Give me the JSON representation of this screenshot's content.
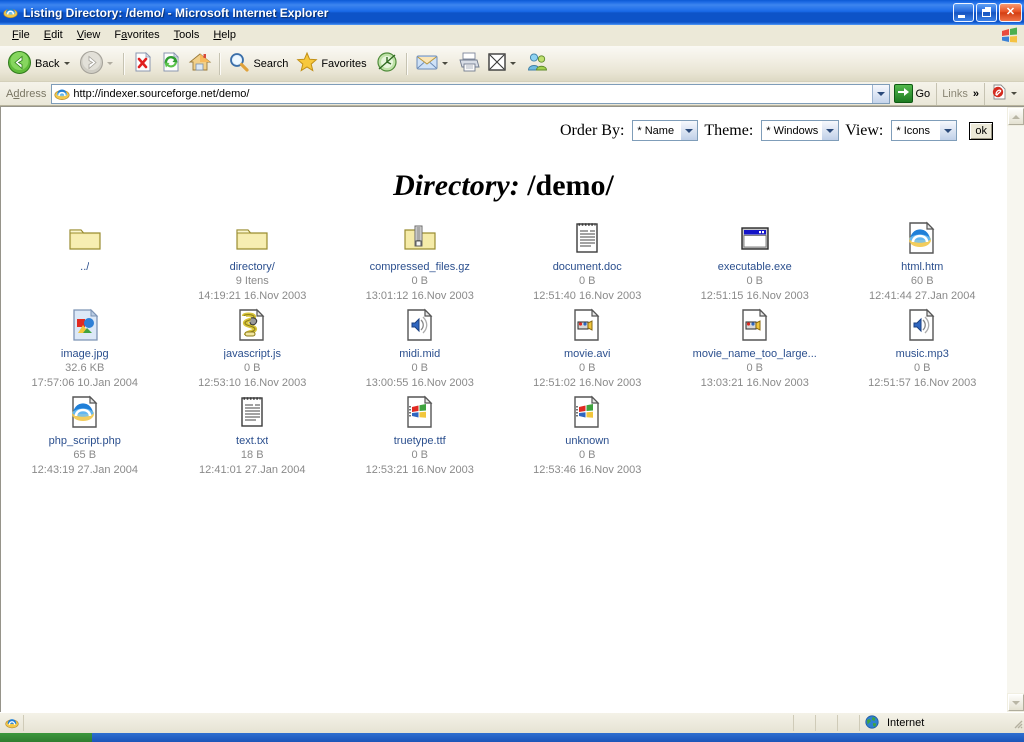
{
  "window": {
    "title": "Listing Directory: /demo/ - Microsoft Internet Explorer",
    "icon": "ie-icon",
    "minimize_label": "Minimize",
    "maximize_label": "Restore",
    "close_label": "Close"
  },
  "menu": {
    "items": [
      {
        "label": "File",
        "accel": "F",
        "rest": "ile"
      },
      {
        "label": "Edit",
        "accel": "E",
        "rest": "dit"
      },
      {
        "label": "View",
        "accel": "V",
        "rest": "iew"
      },
      {
        "label": "Favorites",
        "accel": "a",
        "pre": "F",
        "rest": "vorites"
      },
      {
        "label": "Tools",
        "accel": "T",
        "rest": "ools"
      },
      {
        "label": "Help",
        "accel": "H",
        "rest": "elp"
      }
    ]
  },
  "toolbar": {
    "back_label": "Back",
    "search_label": "Search",
    "favorites_label": "Favorites",
    "buttons": [
      {
        "name": "back-button",
        "icon": "back-arrow-icon"
      },
      {
        "name": "forward-button",
        "icon": "forward-arrow-icon"
      },
      {
        "name": "stop-button",
        "icon": "stop-icon"
      },
      {
        "name": "refresh-button",
        "icon": "refresh-icon"
      },
      {
        "name": "home-button",
        "icon": "home-icon"
      },
      {
        "name": "search-button",
        "icon": "search-icon"
      },
      {
        "name": "favorites-button",
        "icon": "star-icon"
      },
      {
        "name": "history-button",
        "icon": "history-icon"
      },
      {
        "name": "mail-button",
        "icon": "mail-icon"
      },
      {
        "name": "print-button",
        "icon": "printer-icon"
      },
      {
        "name": "edit-button",
        "icon": "edit-page-icon"
      },
      {
        "name": "messenger-button",
        "icon": "messenger-icon"
      }
    ]
  },
  "address": {
    "label": "Address",
    "label_accel": "d",
    "url": "http://indexer.sourceforge.net/demo/",
    "go_label": "Go",
    "links_label": "Links",
    "chevron": "»"
  },
  "page_controls": {
    "order_by_label": "Order By:",
    "order_by_value": "* Name",
    "theme_label": "Theme:",
    "theme_value": "* Windows",
    "view_label": "View:",
    "view_value": "* Icons",
    "ok_label": "ok"
  },
  "heading": {
    "label": "Directory:",
    "path": "/demo/"
  },
  "files": [
    {
      "name": "../",
      "size": "",
      "date": "",
      "icon": "folder-icon"
    },
    {
      "name": "directory/",
      "size": "9 Itens",
      "date": "14:19:21 16.Nov 2003",
      "icon": "folder-icon"
    },
    {
      "name": "compressed_files.gz",
      "size": "0 B",
      "date": "13:01:12 16.Nov 2003",
      "icon": "archive-folder-icon"
    },
    {
      "name": "document.doc",
      "size": "0 B",
      "date": "12:51:40 16.Nov 2003",
      "icon": "document-icon"
    },
    {
      "name": "executable.exe",
      "size": "0 B",
      "date": "12:51:15 16.Nov 2003",
      "icon": "application-window-icon"
    },
    {
      "name": "html.htm",
      "size": "60 B",
      "date": "12:41:44 27.Jan 2004",
      "icon": "html-page-icon"
    },
    {
      "name": "image.jpg",
      "size": "32.6 KB",
      "date": "17:57:06 10.Jan 2004",
      "icon": "image-file-icon"
    },
    {
      "name": "javascript.js",
      "size": "0 B",
      "date": "12:53:10 16.Nov 2003",
      "icon": "script-file-icon"
    },
    {
      "name": "midi.mid",
      "size": "0 B",
      "date": "13:00:55 16.Nov 2003",
      "icon": "audio-file-icon"
    },
    {
      "name": "movie.avi",
      "size": "0 B",
      "date": "12:51:02 16.Nov 2003",
      "icon": "video-file-icon"
    },
    {
      "name": "movie_name_too_large...",
      "size": "0 B",
      "date": "13:03:21 16.Nov 2003",
      "icon": "video-file-icon"
    },
    {
      "name": "music.mp3",
      "size": "0 B",
      "date": "12:51:57 16.Nov 2003",
      "icon": "audio-file-icon"
    },
    {
      "name": "php_script.php",
      "size": "65 B",
      "date": "12:43:19 27.Jan 2004",
      "icon": "html-page-icon"
    },
    {
      "name": "text.txt",
      "size": "18 B",
      "date": "12:41:01 27.Jan 2004",
      "icon": "document-icon"
    },
    {
      "name": "truetype.ttf",
      "size": "0 B",
      "date": "12:53:21 16.Nov 2003",
      "icon": "font-file-icon"
    },
    {
      "name": "unknown",
      "size": "0 B",
      "date": "12:53:46 16.Nov 2003",
      "icon": "font-file-icon"
    }
  ],
  "statusbar": {
    "message": "",
    "zone_label": "Internet",
    "zone_icon": "globe-icon"
  },
  "colors": {
    "titlebar_blue": "#0d53c8",
    "link_blue": "#2b4f8e",
    "meta_gray": "#8a8a8a",
    "chrome_beige": "#ece9d8"
  }
}
